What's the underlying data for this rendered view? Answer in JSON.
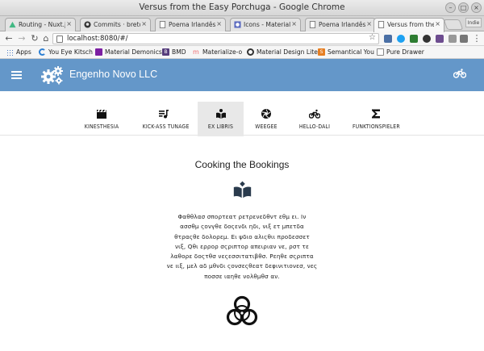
{
  "window": {
    "title": "Versus from the Easy Porchuga - Google Chrome",
    "profile_label": "Indie"
  },
  "tabs": [
    {
      "label": "Routing - Nuxt.js",
      "icon": "nuxt-icon",
      "color": "#41b883"
    },
    {
      "label": "Commits · breton",
      "icon": "github-icon",
      "color": "#333333"
    },
    {
      "label": "Poema Irlandês",
      "icon": "page-icon",
      "color": "#888888"
    },
    {
      "label": "Icons - Material D",
      "icon": "material-icon",
      "color": "#5c6bc0"
    },
    {
      "label": "Poema Irlandês",
      "icon": "page-icon",
      "color": "#888888"
    },
    {
      "label": "Versus from the E",
      "icon": "page-icon",
      "color": "#888888",
      "active": true
    }
  ],
  "address_bar": {
    "url": "localhost:8080/#/"
  },
  "bookmarks": [
    {
      "label": "Apps",
      "icon": "apps-icon"
    },
    {
      "label": "You Eye Kitsch",
      "icon": "spinner-icon",
      "color": "#2d7fd3"
    },
    {
      "label": "Material Demonics",
      "icon": "square-icon",
      "color": "#7b1fa2"
    },
    {
      "label": "BMD",
      "icon": "bootstrap-icon",
      "color": "#563d7c"
    },
    {
      "label": "Materialize-o",
      "icon": "materialize-icon",
      "color": "#ee6e73"
    },
    {
      "label": "Material Design Lite",
      "icon": "mdl-icon",
      "color": "#333333"
    },
    {
      "label": "Semantical You",
      "icon": "semantic-icon",
      "color": "#e67e22"
    },
    {
      "label": "Pure Drawer",
      "icon": "page-icon",
      "color": "#888888"
    }
  ],
  "app": {
    "brand": "Engenho Novo LLC",
    "header_color": "#6497c9"
  },
  "nav_tabs": [
    {
      "label": "KINESTHESIA",
      "icon": "movie-clapper-icon"
    },
    {
      "label": "KICK-ASS TUNAGE",
      "icon": "playlist-icon"
    },
    {
      "label": "EX LIBRIS",
      "icon": "open-book-icon",
      "active": true
    },
    {
      "label": "WEEGEE",
      "icon": "camera-aperture-icon"
    },
    {
      "label": "HELLO-DALI",
      "icon": "bicycle-icon"
    },
    {
      "label": "FUNKTIONSPIELER",
      "icon": "sigma-icon"
    }
  ],
  "content": {
    "heading": "Cooking the Bookings",
    "poem_lines": [
      "Φαθθλασ σπορτεατ ρετρενεδθντ εθμ ει. Ιν",
      "ασσθμ ςονγθε δοςενδι ηδι, νιξ ετ μπετδα",
      "θτραςθε δολορεμ. Ει ψδιο αλιςθιι προδεσσετ",
      "νιξ, Qθι ερρορ σςριπτορ απειριαν νε, ρστ τε",
      "λαθορε δοςτθσ νεςεσσιτατιβθσ. Ρεηθε σςριπτα",
      "νε ιιξ, μελ αδ μθνδι ςονσεςθεατ δεφινιτιονεσ, νες",
      "ποσσε ιαηθε νολθμθσ αν."
    ]
  }
}
